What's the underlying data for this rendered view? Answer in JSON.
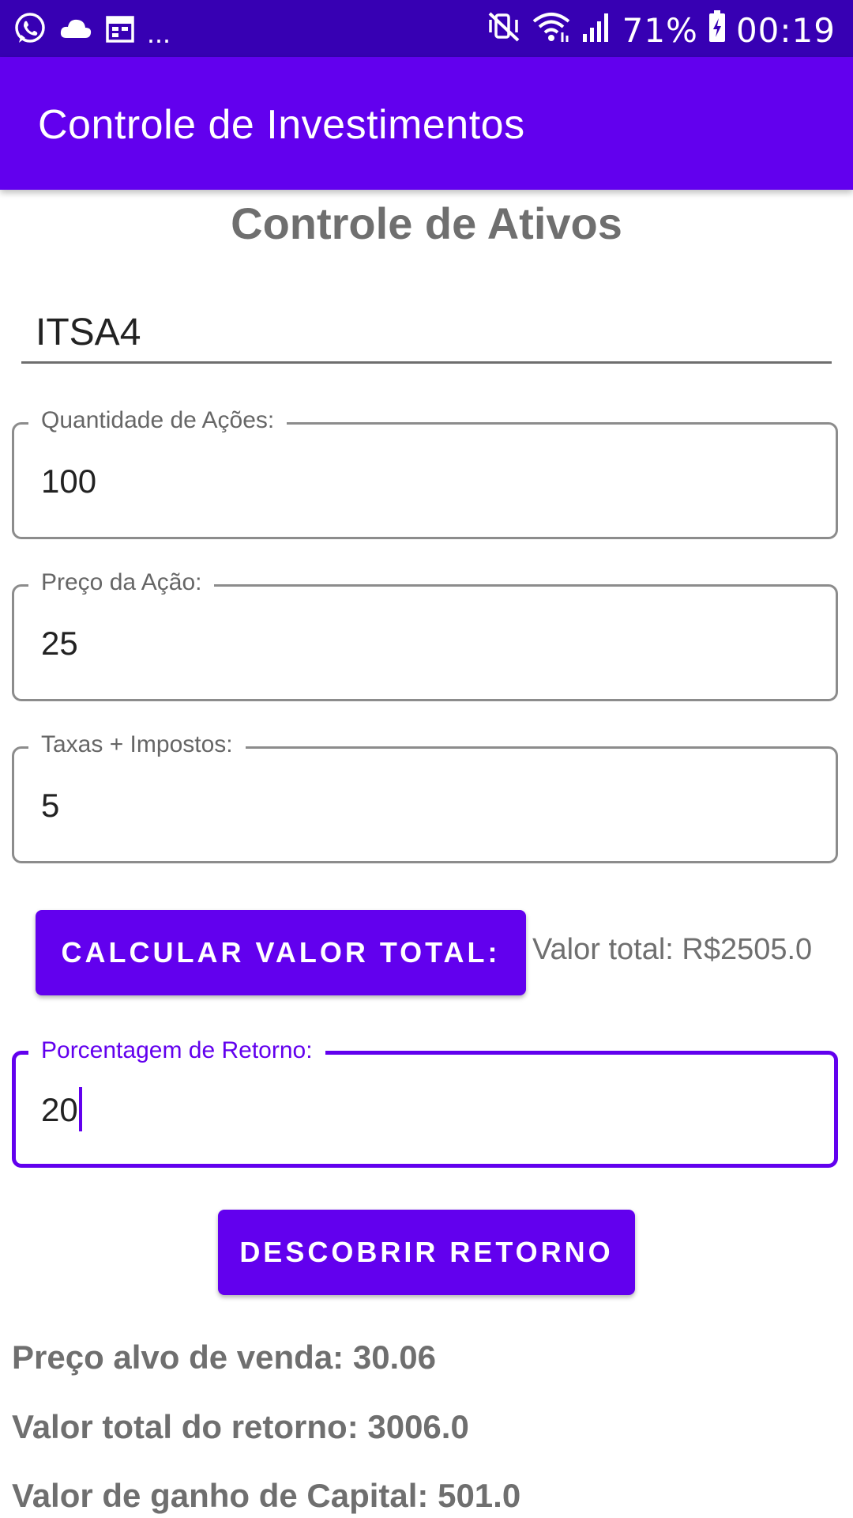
{
  "status_bar": {
    "icons_left": [
      "whatsapp-icon",
      "cloud-icon",
      "calendar-icon"
    ],
    "overflow": "...",
    "icons_right": [
      "mute-vibrate-icon",
      "wifi-icon",
      "signal-icon",
      "battery-charging-icon"
    ],
    "battery": "71%",
    "time": "00:19"
  },
  "app_bar": {
    "title": "Controle de Investimentos"
  },
  "form": {
    "heading": "Controle de Ativos",
    "ticker_value": "ITSA4",
    "quantity": {
      "label": "Quantidade de Ações:",
      "value": "100"
    },
    "price": {
      "label": "Preço da Ação:",
      "value": "25"
    },
    "fees": {
      "label": "Taxas + Impostos:",
      "value": "5"
    },
    "calc_button_label": "CALCULAR VALOR TOTAL:",
    "total_value_text": "Valor total: R$2505.0",
    "return_pct": {
      "label": "Porcentagem de Retorno:",
      "value": "20"
    },
    "return_button_label": "DESCOBRIR RETORNO"
  },
  "results": {
    "target_price": "Preço alvo de venda: 30.06",
    "total_return": "Valor total do retorno: 3006.0",
    "capital_gain": "Valor de ganho de Capital: 501.0"
  },
  "colors": {
    "status_bar": "#3700B3",
    "primary": "#6200EE",
    "muted_text": "#6f6f6f"
  }
}
